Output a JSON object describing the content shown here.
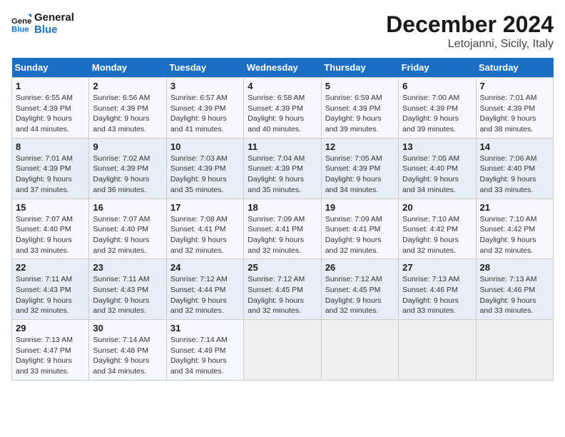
{
  "logo": {
    "line1": "General",
    "line2": "Blue"
  },
  "title": "December 2024",
  "subtitle": "Letojanni, Sicily, Italy",
  "days_of_week": [
    "Sunday",
    "Monday",
    "Tuesday",
    "Wednesday",
    "Thursday",
    "Friday",
    "Saturday"
  ],
  "weeks": [
    [
      {
        "day": "1",
        "sunrise": "6:55 AM",
        "sunset": "4:39 PM",
        "daylight": "9 hours and 44 minutes."
      },
      {
        "day": "2",
        "sunrise": "6:56 AM",
        "sunset": "4:39 PM",
        "daylight": "9 hours and 43 minutes."
      },
      {
        "day": "3",
        "sunrise": "6:57 AM",
        "sunset": "4:39 PM",
        "daylight": "9 hours and 41 minutes."
      },
      {
        "day": "4",
        "sunrise": "6:58 AM",
        "sunset": "4:39 PM",
        "daylight": "9 hours and 40 minutes."
      },
      {
        "day": "5",
        "sunrise": "6:59 AM",
        "sunset": "4:39 PM",
        "daylight": "9 hours and 39 minutes."
      },
      {
        "day": "6",
        "sunrise": "7:00 AM",
        "sunset": "4:39 PM",
        "daylight": "9 hours and 39 minutes."
      },
      {
        "day": "7",
        "sunrise": "7:01 AM",
        "sunset": "4:39 PM",
        "daylight": "9 hours and 38 minutes."
      }
    ],
    [
      {
        "day": "8",
        "sunrise": "7:01 AM",
        "sunset": "4:39 PM",
        "daylight": "9 hours and 37 minutes."
      },
      {
        "day": "9",
        "sunrise": "7:02 AM",
        "sunset": "4:39 PM",
        "daylight": "9 hours and 36 minutes."
      },
      {
        "day": "10",
        "sunrise": "7:03 AM",
        "sunset": "4:39 PM",
        "daylight": "9 hours and 35 minutes."
      },
      {
        "day": "11",
        "sunrise": "7:04 AM",
        "sunset": "4:39 PM",
        "daylight": "9 hours and 35 minutes."
      },
      {
        "day": "12",
        "sunrise": "7:05 AM",
        "sunset": "4:39 PM",
        "daylight": "9 hours and 34 minutes."
      },
      {
        "day": "13",
        "sunrise": "7:05 AM",
        "sunset": "4:40 PM",
        "daylight": "9 hours and 34 minutes."
      },
      {
        "day": "14",
        "sunrise": "7:06 AM",
        "sunset": "4:40 PM",
        "daylight": "9 hours and 33 minutes."
      }
    ],
    [
      {
        "day": "15",
        "sunrise": "7:07 AM",
        "sunset": "4:40 PM",
        "daylight": "9 hours and 33 minutes."
      },
      {
        "day": "16",
        "sunrise": "7:07 AM",
        "sunset": "4:40 PM",
        "daylight": "9 hours and 32 minutes."
      },
      {
        "day": "17",
        "sunrise": "7:08 AM",
        "sunset": "4:41 PM",
        "daylight": "9 hours and 32 minutes."
      },
      {
        "day": "18",
        "sunrise": "7:09 AM",
        "sunset": "4:41 PM",
        "daylight": "9 hours and 32 minutes."
      },
      {
        "day": "19",
        "sunrise": "7:09 AM",
        "sunset": "4:41 PM",
        "daylight": "9 hours and 32 minutes."
      },
      {
        "day": "20",
        "sunrise": "7:10 AM",
        "sunset": "4:42 PM",
        "daylight": "9 hours and 32 minutes."
      },
      {
        "day": "21",
        "sunrise": "7:10 AM",
        "sunset": "4:42 PM",
        "daylight": "9 hours and 32 minutes."
      }
    ],
    [
      {
        "day": "22",
        "sunrise": "7:11 AM",
        "sunset": "4:43 PM",
        "daylight": "9 hours and 32 minutes."
      },
      {
        "day": "23",
        "sunrise": "7:11 AM",
        "sunset": "4:43 PM",
        "daylight": "9 hours and 32 minutes."
      },
      {
        "day": "24",
        "sunrise": "7:12 AM",
        "sunset": "4:44 PM",
        "daylight": "9 hours and 32 minutes."
      },
      {
        "day": "25",
        "sunrise": "7:12 AM",
        "sunset": "4:45 PM",
        "daylight": "9 hours and 32 minutes."
      },
      {
        "day": "26",
        "sunrise": "7:12 AM",
        "sunset": "4:45 PM",
        "daylight": "9 hours and 32 minutes."
      },
      {
        "day": "27",
        "sunrise": "7:13 AM",
        "sunset": "4:46 PM",
        "daylight": "9 hours and 33 minutes."
      },
      {
        "day": "28",
        "sunrise": "7:13 AM",
        "sunset": "4:46 PM",
        "daylight": "9 hours and 33 minutes."
      }
    ],
    [
      {
        "day": "29",
        "sunrise": "7:13 AM",
        "sunset": "4:47 PM",
        "daylight": "9 hours and 33 minutes."
      },
      {
        "day": "30",
        "sunrise": "7:14 AM",
        "sunset": "4:48 PM",
        "daylight": "9 hours and 34 minutes."
      },
      {
        "day": "31",
        "sunrise": "7:14 AM",
        "sunset": "4:49 PM",
        "daylight": "9 hours and 34 minutes."
      },
      null,
      null,
      null,
      null
    ]
  ],
  "labels": {
    "sunrise": "Sunrise:",
    "sunset": "Sunset:",
    "daylight": "Daylight:"
  },
  "colors": {
    "header_bg": "#1a6fc4",
    "header_text": "#ffffff",
    "logo_blue": "#1a6fc4"
  }
}
